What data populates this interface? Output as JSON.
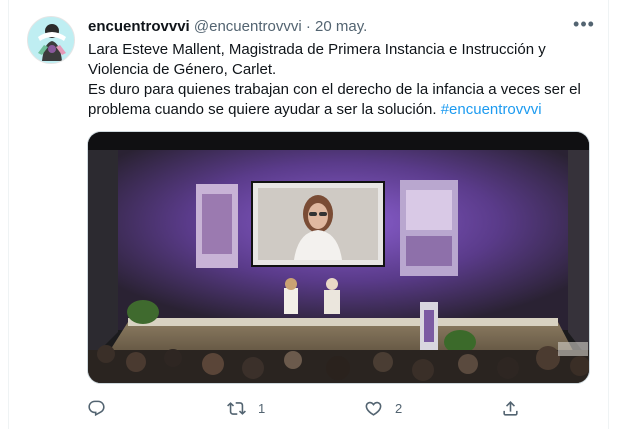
{
  "tweet": {
    "display_name": "encuentrovvvi",
    "handle": "@encuentrovvvi",
    "separator": "·",
    "date": "20 may.",
    "more_label": "•••",
    "text_lines": [
      "Lara Esteve Mallent, Magistrada de Primera Instancia e Instrucción y",
      "Violencia de Género, Carlet.",
      "Es duro para quienes trabajan con el derecho de la infancia a veces ser el",
      "problema cuando se quiere ayudar a ser la solución."
    ],
    "hashtag": "#encuentrovvvi"
  },
  "actions": {
    "reply_count": "",
    "retweet_count": "1",
    "like_count": "2"
  },
  "colors": {
    "accent": "#1d9bf0",
    "muted": "#536471",
    "text": "#0f1419"
  },
  "icons": [
    "reply-icon",
    "retweet-icon",
    "like-icon",
    "share-icon",
    "more-icon"
  ]
}
